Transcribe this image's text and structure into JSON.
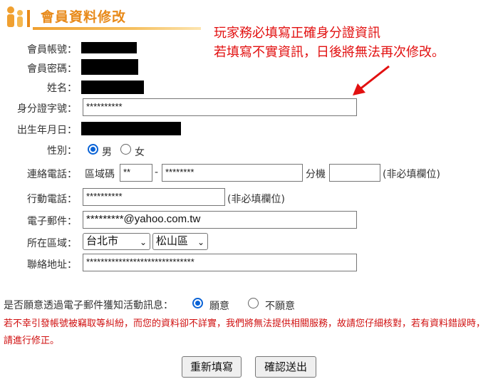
{
  "header": {
    "title": "會員資料修改",
    "accent_color": "#e88a1a"
  },
  "notice": {
    "line1": "玩家務必填寫正確身分證資訊",
    "line2": "若填寫不實資訊，日後將無法再次修改。",
    "color": "#e21010"
  },
  "form": {
    "account": {
      "label": "會員帳號："
    },
    "password": {
      "label": "會員密碼："
    },
    "name": {
      "label": "姓名："
    },
    "id_number": {
      "label": "身分證字號：",
      "value": "**********"
    },
    "birthday": {
      "label": "出生年月日："
    },
    "gender": {
      "label": "性別：",
      "options": [
        "男",
        "女"
      ],
      "selected": "男"
    },
    "phone": {
      "label": "連絡電話：",
      "area_label": "區域碼",
      "area_value": "**",
      "separator": "-",
      "number_value": "********",
      "ext_label": "分機",
      "ext_value": "",
      "note": "(非必填欄位)"
    },
    "mobile": {
      "label": "行動電話：",
      "value": "**********",
      "note": "(非必填欄位)"
    },
    "email": {
      "label": "電子郵件：",
      "value": "*********@yahoo.com.tw"
    },
    "region": {
      "label": "所在區域：",
      "city": "台北市",
      "district": "松山區"
    },
    "address": {
      "label": "聯絡地址：",
      "value": "******************************"
    }
  },
  "subscribe": {
    "question": "是否願意透過電子郵件獲知活動訊息：",
    "options": [
      "願意",
      "不願意"
    ],
    "selected": "願意"
  },
  "warning": "若不幸引發帳號被竊取等糾紛，而您的資料卻不詳實，我們將無法提供相關服務，故請您仔細核對，若有資料錯誤時，請進行修正。",
  "buttons": {
    "reset": "重新填寫",
    "submit": "確認送出"
  }
}
